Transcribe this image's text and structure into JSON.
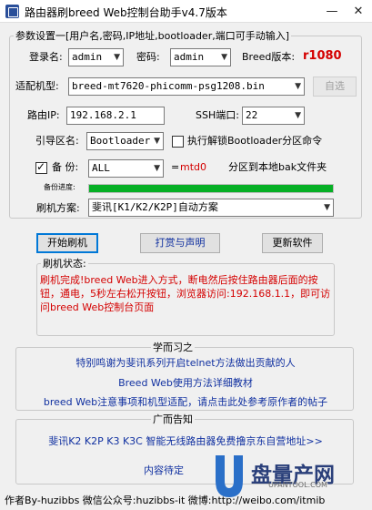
{
  "window": {
    "title": "路由器刷breed Web控制台助手v4.7版本",
    "min_glyph": "—",
    "close_glyph": "✕"
  },
  "params": {
    "legend": "参数设置一[用户名,密码,IP地址,bootloader,端口可手动输入]",
    "login_label": "登录名:",
    "login_value": "admin",
    "password_label": "密码:",
    "password_value": "admin",
    "breed_version_label": "Breed版本:",
    "breed_version_value": "r1080",
    "model_label": "适配机型:",
    "model_value": "breed-mt7620-phicomm-psg1208.bin",
    "auto_select_label": "自选",
    "ip_label": "路由IP:",
    "ip_value": "192.168.2.1",
    "ssh_port_label": "SSH端口:",
    "ssh_port_value": "22",
    "boot_partition_label": "引导区名:",
    "boot_partition_value": "Bootloader",
    "unlock_label": "执行解锁Bootloader分区命令",
    "unlock_checked": false,
    "backup_label": "备  份:",
    "backup_checked": true,
    "backup_value": "ALL",
    "backup_eq": "=",
    "backup_target": "mtd0",
    "backup_note": "分区到本地bak文件夹",
    "progress_label": "备份进度:",
    "progress_percent": 100,
    "flash_scheme_label": "刷机方案:",
    "flash_scheme_value": "斐讯[K1/K2/K2P]自动方案"
  },
  "buttons": {
    "start_flash": "开始刷机",
    "donate": "打赏与声明",
    "update": "更新软件"
  },
  "status": {
    "legend": "刷机状态:",
    "text": "刷机完成!breed Web进入方式，断电然后按住路由器后面的按钮，通电，5秒左右松开按钮，浏览器访问:192.168.1.1，即可访问breed Web控制台页面"
  },
  "learn": {
    "legend": "学而习之",
    "link1": "特别鸣谢为斐讯系列开启telnet方法做出贡献的人",
    "link2": "Breed Web使用方法详细教材",
    "link3": "breed Web注意事项和机型适配，请点击此处参考原作者的帖子"
  },
  "ads": {
    "legend": "广而告知",
    "link1": "斐讯K2 K2P K3 K3C 智能无线路由器免费撸京东自营地址>>",
    "pending": "内容待定"
  },
  "footer": {
    "text": "作者By-huzibbs 微信公众号:huzibbs-it 微博:http://weibo.com/itmib"
  },
  "watermark": {
    "text": "盘量产网",
    "url": "UPANTOOL.COM"
  }
}
